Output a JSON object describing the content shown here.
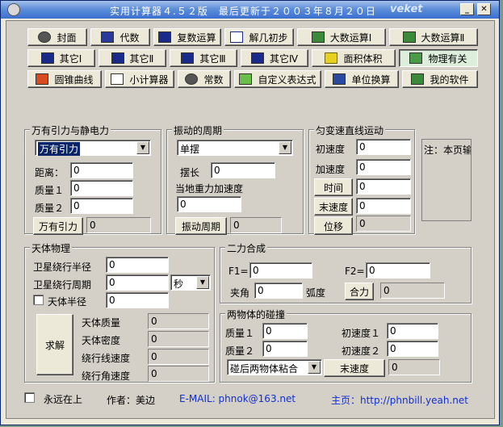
{
  "window": {
    "title": "实用计算器４.５２版　最后更新于２００３年８月２０日",
    "brand": "veket",
    "minimize_glyph": "_",
    "close_glyph": "✕"
  },
  "toolbar": {
    "row1": [
      "封面",
      "代数",
      "复数运算",
      "解几初步",
      "大数运算Ⅰ",
      "大数运算Ⅱ"
    ],
    "row2": [
      "其它Ⅰ",
      "其它Ⅱ",
      "其它Ⅲ",
      "其它Ⅳ",
      "面积体积",
      "物理有关"
    ],
    "row3": [
      "圆锥曲线",
      "小计算器",
      "常数",
      "自定义表达式",
      "单位换算",
      "我的软件"
    ]
  },
  "gravity": {
    "title": "万有引力与静电力",
    "mode": "万有引力",
    "distance_label": "距离：",
    "distance": "0",
    "mass1_label": "质量１",
    "mass1": "0",
    "mass2_label": "质量２",
    "mass2": "0",
    "calc_button": "万有引力",
    "result": "0"
  },
  "vibration": {
    "title": "振动的周期",
    "mode": "单摆",
    "length_label": "摆长",
    "length": "0",
    "gravity_label": "当地重力加速度",
    "gravity": "0",
    "calc_button": "振动周期",
    "result": "0"
  },
  "motion": {
    "title": "匀变速直线运动",
    "v0_label": "初速度",
    "v0": "0",
    "a_label": "加速度",
    "a": "0",
    "t_button": "时间",
    "t": "0",
    "v_button": "末速度",
    "v": "0",
    "s_button": "位移",
    "s": "0"
  },
  "note": {
    "text": "注：本页输"
  },
  "celestial": {
    "title": "天体物理",
    "orbit_radius_label": "卫星绕行半径",
    "orbit_radius": "0",
    "orbit_period_label": "卫星绕行周期",
    "orbit_period": "0",
    "period_unit": "秒",
    "radius_check_label": "天体半径",
    "radius": "0",
    "solve_button": "求解",
    "mass_label": "天体质量",
    "mass": "0",
    "density_label": "天体密度",
    "density": "0",
    "linear_speed_label": "绕行线速度",
    "linear_speed": "0",
    "angular_speed_label": "绕行角速度",
    "angular_speed": "0"
  },
  "force": {
    "title": "二力合成",
    "f1_label": "F1=",
    "f1": "0",
    "f2_label": "F2=",
    "f2": "0",
    "angle_label": "夹角",
    "angle": "0",
    "angle_unit": "弧度",
    "calc_button": "合力",
    "result": "0"
  },
  "collision": {
    "title": "两物体的碰撞",
    "m1_label": "质量１",
    "m1": "0",
    "v1_label": "初速度１",
    "v1": "0",
    "m2_label": "质量２",
    "m2": "0",
    "v2_label": "初速度２",
    "v2": "0",
    "mode": "碰后两物体粘合",
    "calc_button": "末速度",
    "result": "0"
  },
  "footer": {
    "topmost_label": "永远在上",
    "author": "作者：美边",
    "email": "E-MAIL: phnok@163.net",
    "homepage": "主页：http://phnbill.yeah.net"
  }
}
